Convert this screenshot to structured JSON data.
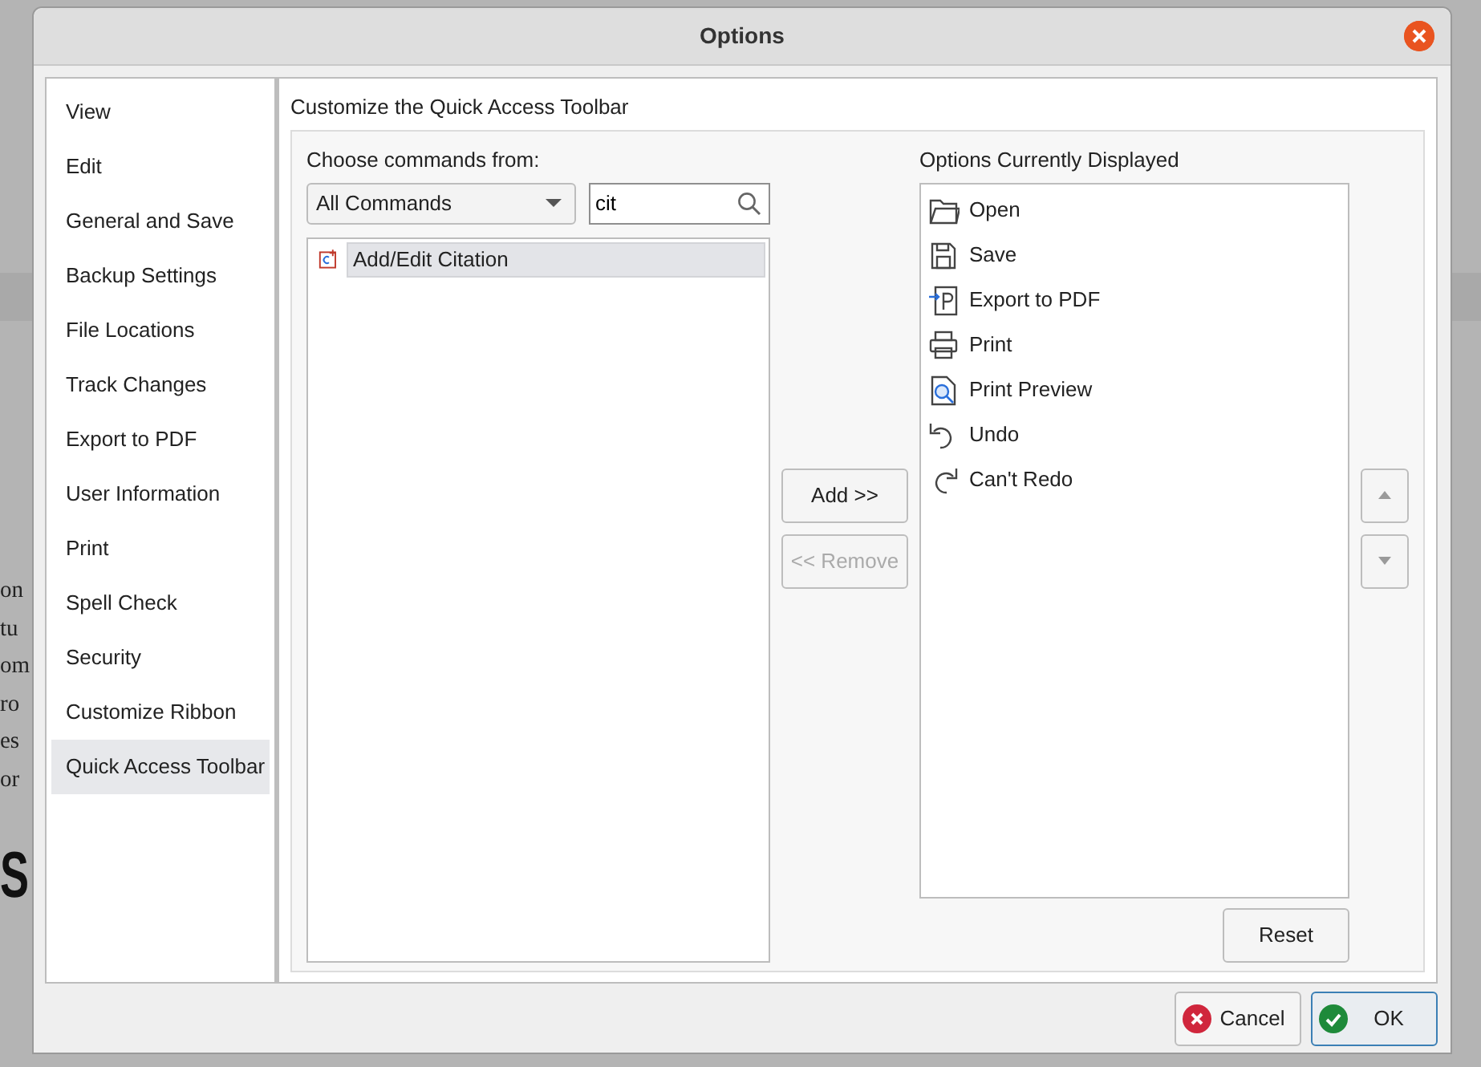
{
  "background": {
    "lines": [
      "on",
      "tu",
      "om",
      "ro",
      "es",
      "or"
    ],
    "heading": "S"
  },
  "window": {
    "title": "Options"
  },
  "sidebar": {
    "items": [
      {
        "label": "View",
        "selected": false
      },
      {
        "label": "Edit",
        "selected": false
      },
      {
        "label": "General and Save",
        "selected": false
      },
      {
        "label": "Backup Settings",
        "selected": false
      },
      {
        "label": "File Locations",
        "selected": false
      },
      {
        "label": "Track Changes",
        "selected": false
      },
      {
        "label": "Export to PDF",
        "selected": false
      },
      {
        "label": "User Information",
        "selected": false
      },
      {
        "label": "Print",
        "selected": false
      },
      {
        "label": "Spell Check",
        "selected": false
      },
      {
        "label": "Security",
        "selected": false
      },
      {
        "label": "Customize Ribbon",
        "selected": false
      },
      {
        "label": "Quick Access Toolbar",
        "selected": true
      }
    ]
  },
  "section_title": "Customize the Quick Access Toolbar",
  "commands": {
    "label": "Choose commands from:",
    "category": "All Commands",
    "search": "cit",
    "items": [
      {
        "label": "Add/Edit Citation",
        "kind": "citation",
        "selected": true
      }
    ]
  },
  "transfer_buttons": [
    {
      "label": "Add >>",
      "disabled": false
    },
    {
      "label": "<< Remove",
      "disabled": true
    }
  ],
  "displayed": {
    "label": "Options Currently Displayed",
    "items": [
      {
        "label": "Open",
        "kind": "open"
      },
      {
        "label": "Save",
        "kind": "save"
      },
      {
        "label": "Export to PDF",
        "kind": "pdf"
      },
      {
        "label": "Print",
        "kind": "print"
      },
      {
        "label": "Print Preview",
        "kind": "preview"
      },
      {
        "label": "Undo",
        "kind": "undo"
      },
      {
        "label": "Can't Redo",
        "kind": "redo"
      }
    ]
  },
  "order_buttons": [
    {
      "kind": "up"
    },
    {
      "kind": "down"
    }
  ],
  "reset": "Reset",
  "dialog_buttons": [
    {
      "label": "Cancel",
      "kind": "cancel",
      "default": false
    },
    {
      "label": "OK",
      "kind": "ok",
      "default": true
    }
  ]
}
